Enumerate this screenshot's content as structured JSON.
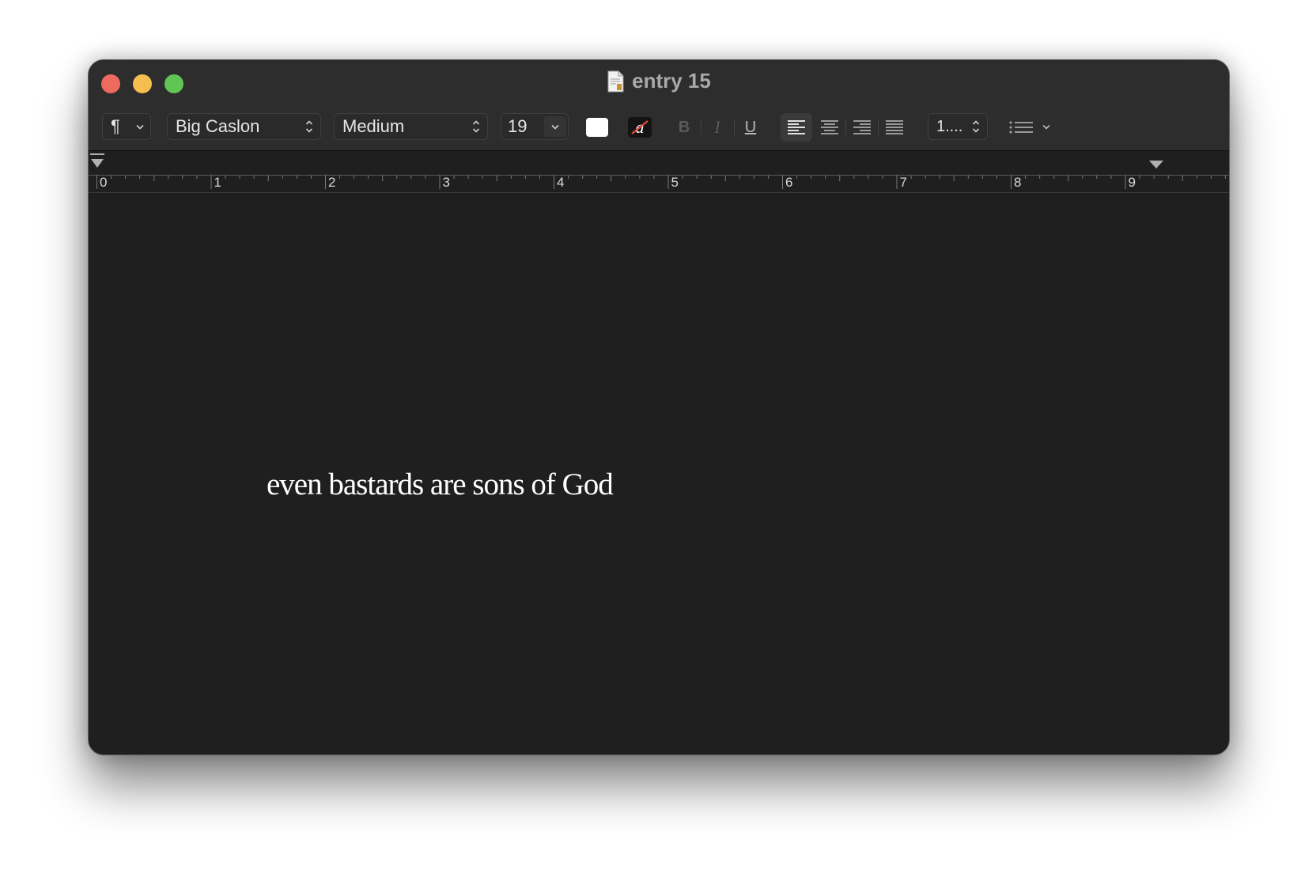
{
  "window": {
    "title": "entry 15"
  },
  "toolbar": {
    "paragraph_style_symbol": "¶",
    "font_family": "Big Caslon",
    "font_style": "Medium",
    "font_size": "19",
    "bold_label": "B",
    "italic_label": "I",
    "underline_label": "U",
    "highlight_glyph": "a",
    "line_spacing": "1....",
    "text_color": "#ffffff",
    "alignment_selected": "left"
  },
  "ruler": {
    "marks": [
      "0",
      "1",
      "2",
      "3",
      "4",
      "5",
      "6",
      "7",
      "8",
      "9"
    ]
  },
  "document": {
    "text": "even bastards are sons of God"
  }
}
